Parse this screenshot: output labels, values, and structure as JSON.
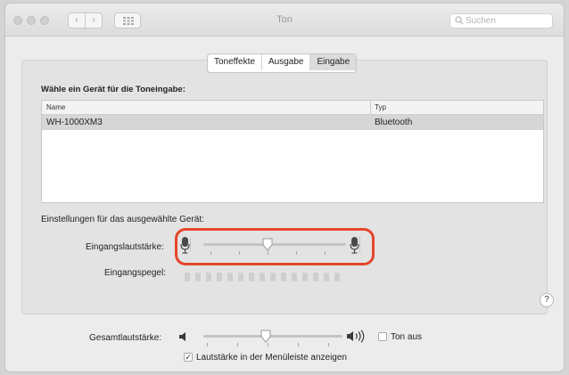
{
  "window": {
    "title": "Ton"
  },
  "toolbar": {
    "back_glyph": "‹",
    "forward_glyph": "›",
    "search_placeholder": "Suchen"
  },
  "tabs": [
    {
      "label": "Toneffekte",
      "active": false
    },
    {
      "label": "Ausgabe",
      "active": false
    },
    {
      "label": "Eingabe",
      "active": true
    }
  ],
  "input": {
    "section_title": "Wähle ein Gerät für die Toneingabe:",
    "columns": {
      "name": "Name",
      "type": "Typ"
    },
    "devices": [
      {
        "name": "WH-1000XM3",
        "type": "Bluetooth",
        "selected": true
      }
    ],
    "settings_title": "Einstellungen für das ausgewählte Gerät:",
    "volume_label": "Eingangslautstärke:",
    "volume_level": 0.45,
    "level_label": "Eingangspegel:",
    "level_segments": 15,
    "level_active": 0
  },
  "help_glyph": "?",
  "output": {
    "volume_label": "Gesamtlautstärke:",
    "volume_level": 0.45,
    "mute_label": "Ton aus",
    "mute_checked": false,
    "menubar_label": "Lautstärke in der Menüleiste anzeigen",
    "menubar_checked": true
  },
  "colors": {
    "highlight": "#e6452c",
    "selected_row": "#d6d6d6"
  },
  "icons": [
    "back-icon",
    "forward-icon",
    "grid-icon",
    "search-icon",
    "microphone-icon",
    "speaker-icon",
    "help-icon"
  ]
}
